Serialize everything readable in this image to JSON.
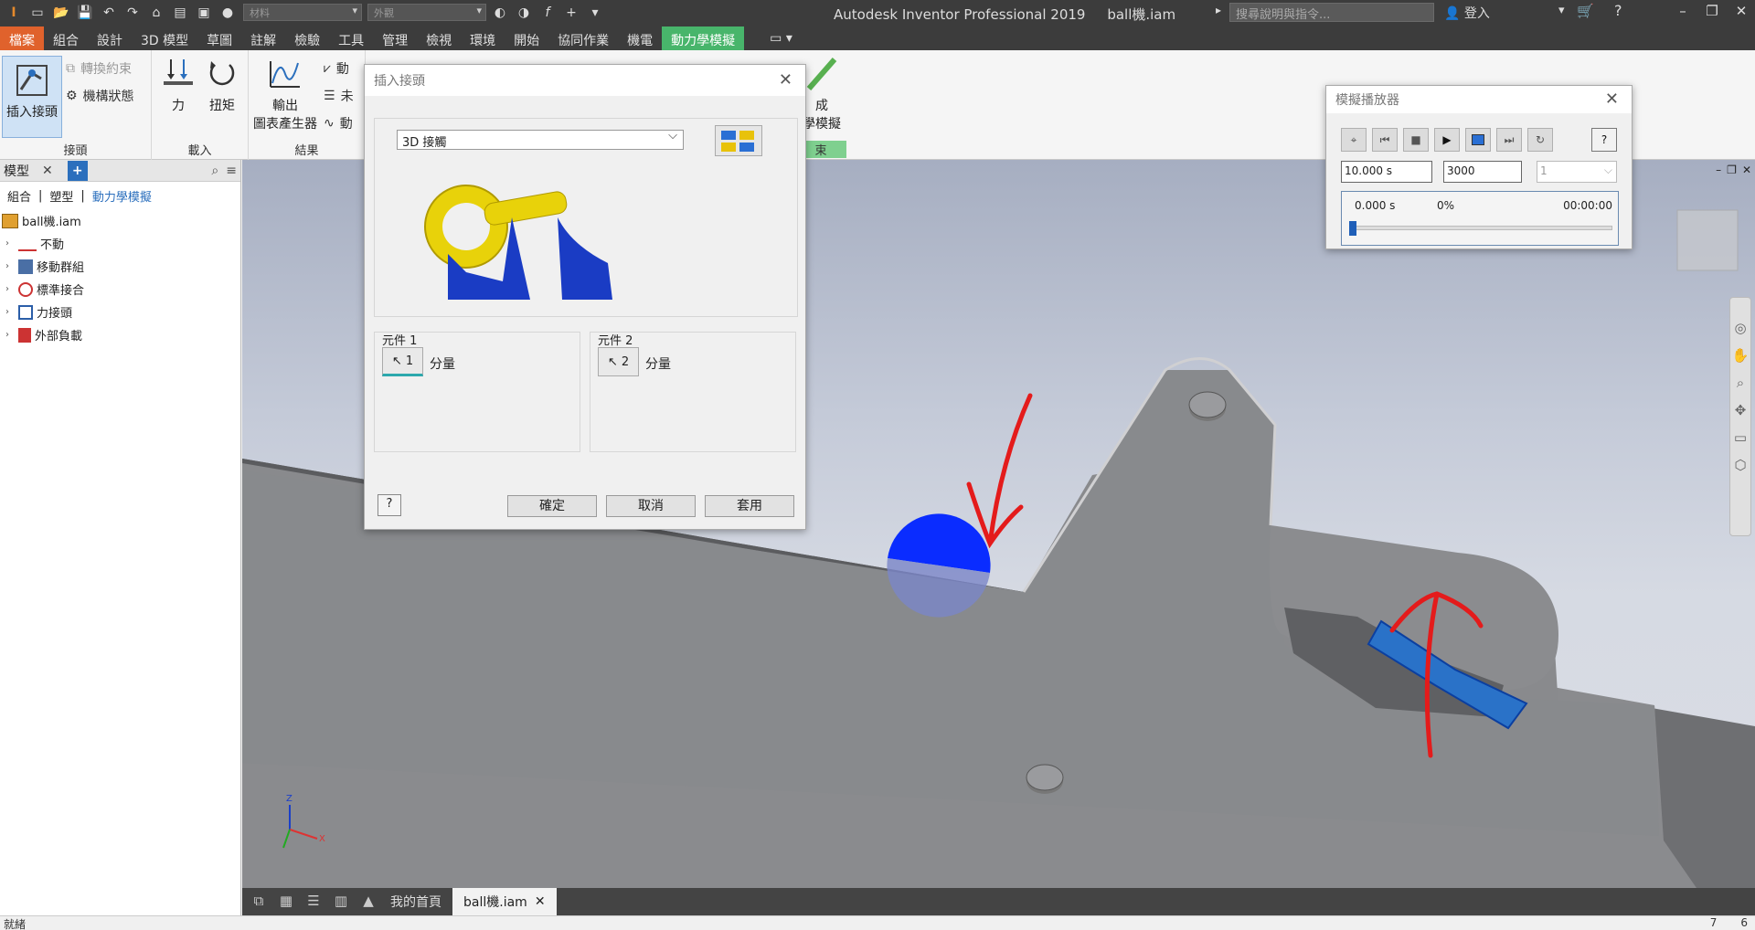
{
  "app": {
    "title": "Autodesk Inventor Professional 2019",
    "document": "ball機.iam",
    "search_placeholder": "搜尋說明與指令...",
    "signin": "登入",
    "material_placeholder": "材料",
    "appearance_placeholder": "外觀"
  },
  "ribbon_tabs": [
    "檔案",
    "組合",
    "設計",
    "3D 模型",
    "草圖",
    "註解",
    "檢驗",
    "工具",
    "管理",
    "檢視",
    "環境",
    "開始",
    "協同作業",
    "機電",
    "動力學模擬"
  ],
  "ribbon": {
    "insert_joint": "插入接頭",
    "convert_constraints": "轉換約束",
    "mechanism_status": "機構狀態",
    "group_joint": "接頭",
    "force": "力",
    "torque": "扭矩",
    "group_load": "載入",
    "output_graph_1": "輸出",
    "output_graph_2": "圖表產生器",
    "group_results": "結果",
    "results_item_1": "動",
    "results_item_2": "未",
    "results_item_3": "動",
    "finish_1": "成",
    "finish_2": "學模擬",
    "group_finish": "束"
  },
  "browser": {
    "title": "模型",
    "filters": [
      "組合",
      "塑型",
      "動力學模擬"
    ],
    "root": "ball機.iam",
    "items": [
      "不動",
      "移動群組",
      "標準接合",
      "力接頭",
      "外部負載"
    ]
  },
  "insert_joint_dialog": {
    "title": "插入接頭",
    "joint_type": "3D 接觸",
    "component1_label": "元件 1",
    "component1_btn": "1",
    "component1_text": "分量",
    "component2_label": "元件 2",
    "component2_btn": "2",
    "component2_text": "分量",
    "ok": "確定",
    "cancel": "取消",
    "apply": "套用"
  },
  "player_dialog": {
    "title": "模擬播放器",
    "final_time": "10.000 s",
    "images": "3000",
    "filter": "1",
    "current_time": "0.000 s",
    "percent": "0%",
    "elapsed": "00:00:00",
    "progress": 0
  },
  "doc_tabs": {
    "home": "我的首頁",
    "active": "ball機.iam"
  },
  "status": {
    "text": "就緒",
    "num1": "7",
    "num2": "6"
  },
  "colors": {
    "ribbon_active_tab": "#48b56b",
    "file_tab": "#e0622c",
    "selected_blue": "#0a2cff",
    "annotation_red": "#e41b1b"
  }
}
